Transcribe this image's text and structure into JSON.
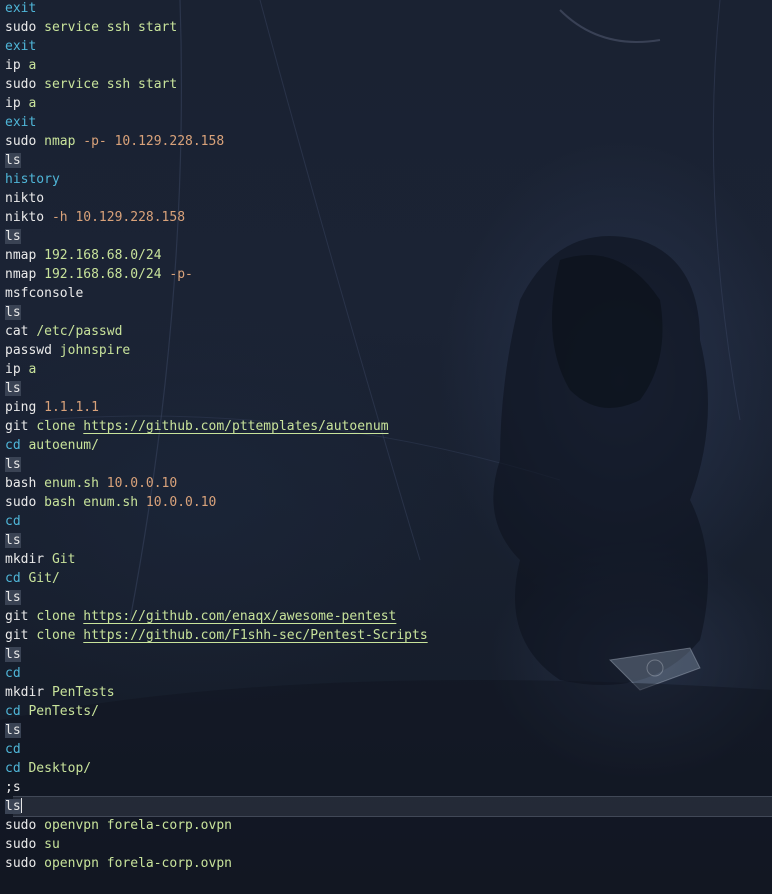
{
  "colors": {
    "background": "#1a2232",
    "command": "#eaeaea",
    "keyword": "#4fb6d8",
    "argument": "#c8e39b",
    "number": "#d9a27a",
    "highlight_bg": "#3a4354"
  },
  "history": [
    [
      {
        "text": "exit",
        "style": "kw"
      }
    ],
    [
      {
        "text": "sudo ",
        "style": "cmd"
      },
      {
        "text": "service ssh start",
        "style": "arg"
      }
    ],
    [
      {
        "text": "exit",
        "style": "kw"
      }
    ],
    [
      {
        "text": "ip ",
        "style": "cmd"
      },
      {
        "text": "a",
        "style": "arg"
      }
    ],
    [
      {
        "text": "sudo ",
        "style": "cmd"
      },
      {
        "text": "service ssh start",
        "style": "arg"
      }
    ],
    [
      {
        "text": "ip ",
        "style": "cmd"
      },
      {
        "text": "a",
        "style": "arg"
      }
    ],
    [
      {
        "text": "exit",
        "style": "kw"
      }
    ],
    [
      {
        "text": "sudo ",
        "style": "cmd"
      },
      {
        "text": "nmap ",
        "style": "arg"
      },
      {
        "text": "-p- ",
        "style": "opt"
      },
      {
        "text": "10.129.228.158",
        "style": "num"
      }
    ],
    [
      {
        "text": "ls",
        "style": "hl"
      }
    ],
    [
      {
        "text": "history",
        "style": "kw"
      }
    ],
    [
      {
        "text": "nikto",
        "style": "cmd"
      }
    ],
    [
      {
        "text": "nikto ",
        "style": "cmd"
      },
      {
        "text": "-h ",
        "style": "opt"
      },
      {
        "text": "10.129.228.158",
        "style": "num"
      }
    ],
    [
      {
        "text": "ls",
        "style": "hl"
      }
    ],
    [
      {
        "text": "nmap ",
        "style": "cmd"
      },
      {
        "text": "192.168.68.0/24",
        "style": "arg"
      }
    ],
    [
      {
        "text": "nmap ",
        "style": "cmd"
      },
      {
        "text": "192.168.68.0/24 ",
        "style": "arg"
      },
      {
        "text": "-p-",
        "style": "opt"
      }
    ],
    [
      {
        "text": "msfconsole",
        "style": "cmd"
      }
    ],
    [
      {
        "text": "ls",
        "style": "hl"
      }
    ],
    [
      {
        "text": "cat ",
        "style": "cmd"
      },
      {
        "text": "/etc/passwd",
        "style": "arg"
      }
    ],
    [
      {
        "text": "passwd ",
        "style": "cmd"
      },
      {
        "text": "johnspire",
        "style": "arg"
      }
    ],
    [
      {
        "text": "ip ",
        "style": "cmd"
      },
      {
        "text": "a",
        "style": "arg"
      }
    ],
    [
      {
        "text": "ls",
        "style": "hl"
      }
    ],
    [
      {
        "text": "ping ",
        "style": "cmd"
      },
      {
        "text": "1.1.1.1",
        "style": "num"
      }
    ],
    [
      {
        "text": "git ",
        "style": "cmd"
      },
      {
        "text": "clone ",
        "style": "arg"
      },
      {
        "text": "https://github.com/pttemplates/autoenum",
        "style": "url"
      }
    ],
    [
      {
        "text": "cd ",
        "style": "kw"
      },
      {
        "text": "autoenum/",
        "style": "arg"
      }
    ],
    [
      {
        "text": "ls",
        "style": "hl"
      }
    ],
    [
      {
        "text": "bash ",
        "style": "cmd"
      },
      {
        "text": "enum.sh ",
        "style": "arg"
      },
      {
        "text": "10.0.0.10",
        "style": "num"
      }
    ],
    [
      {
        "text": "sudo ",
        "style": "cmd"
      },
      {
        "text": "bash ",
        "style": "arg"
      },
      {
        "text": "enum.sh ",
        "style": "arg"
      },
      {
        "text": "10.0.0.10",
        "style": "num"
      }
    ],
    [
      {
        "text": "cd",
        "style": "kw"
      }
    ],
    [
      {
        "text": "ls",
        "style": "hl"
      }
    ],
    [
      {
        "text": "mkdir ",
        "style": "cmd"
      },
      {
        "text": "Git",
        "style": "arg"
      }
    ],
    [
      {
        "text": "cd ",
        "style": "kw"
      },
      {
        "text": "Git/",
        "style": "arg"
      }
    ],
    [
      {
        "text": "ls",
        "style": "hl"
      }
    ],
    [
      {
        "text": "git ",
        "style": "cmd"
      },
      {
        "text": "clone ",
        "style": "arg"
      },
      {
        "text": "https://github.com/enaqx/awesome-pentest",
        "style": "url"
      }
    ],
    [
      {
        "text": "git ",
        "style": "cmd"
      },
      {
        "text": "clone ",
        "style": "arg"
      },
      {
        "text": "https://github.com/F1shh-sec/Pentest-Scripts",
        "style": "url"
      }
    ],
    [
      {
        "text": "ls",
        "style": "hl"
      }
    ],
    [
      {
        "text": "cd",
        "style": "kw"
      }
    ],
    [
      {
        "text": "mkdir ",
        "style": "cmd"
      },
      {
        "text": "PenTests",
        "style": "arg"
      }
    ],
    [
      {
        "text": "cd ",
        "style": "kw"
      },
      {
        "text": "PenTests/",
        "style": "arg"
      }
    ],
    [
      {
        "text": "ls",
        "style": "hl"
      }
    ],
    [
      {
        "text": "cd",
        "style": "kw"
      }
    ],
    [
      {
        "text": "cd ",
        "style": "kw"
      },
      {
        "text": "Desktop/",
        "style": "arg"
      }
    ],
    [
      {
        "text": ";s",
        "style": "cmd"
      }
    ],
    [
      {
        "text": "ls",
        "style": "hl",
        "cursor": true
      }
    ],
    [
      {
        "text": "sudo ",
        "style": "cmd"
      },
      {
        "text": "openvpn ",
        "style": "arg"
      },
      {
        "text": "forela-corp.ovpn",
        "style": "arg"
      }
    ],
    [
      {
        "text": "sudo ",
        "style": "cmd"
      },
      {
        "text": "su",
        "style": "arg"
      }
    ],
    [
      {
        "text": "sudo ",
        "style": "cmd"
      },
      {
        "text": "openvpn ",
        "style": "arg"
      },
      {
        "text": "forela-corp.ovpn",
        "style": "arg"
      }
    ]
  ],
  "current_line_index": 42
}
